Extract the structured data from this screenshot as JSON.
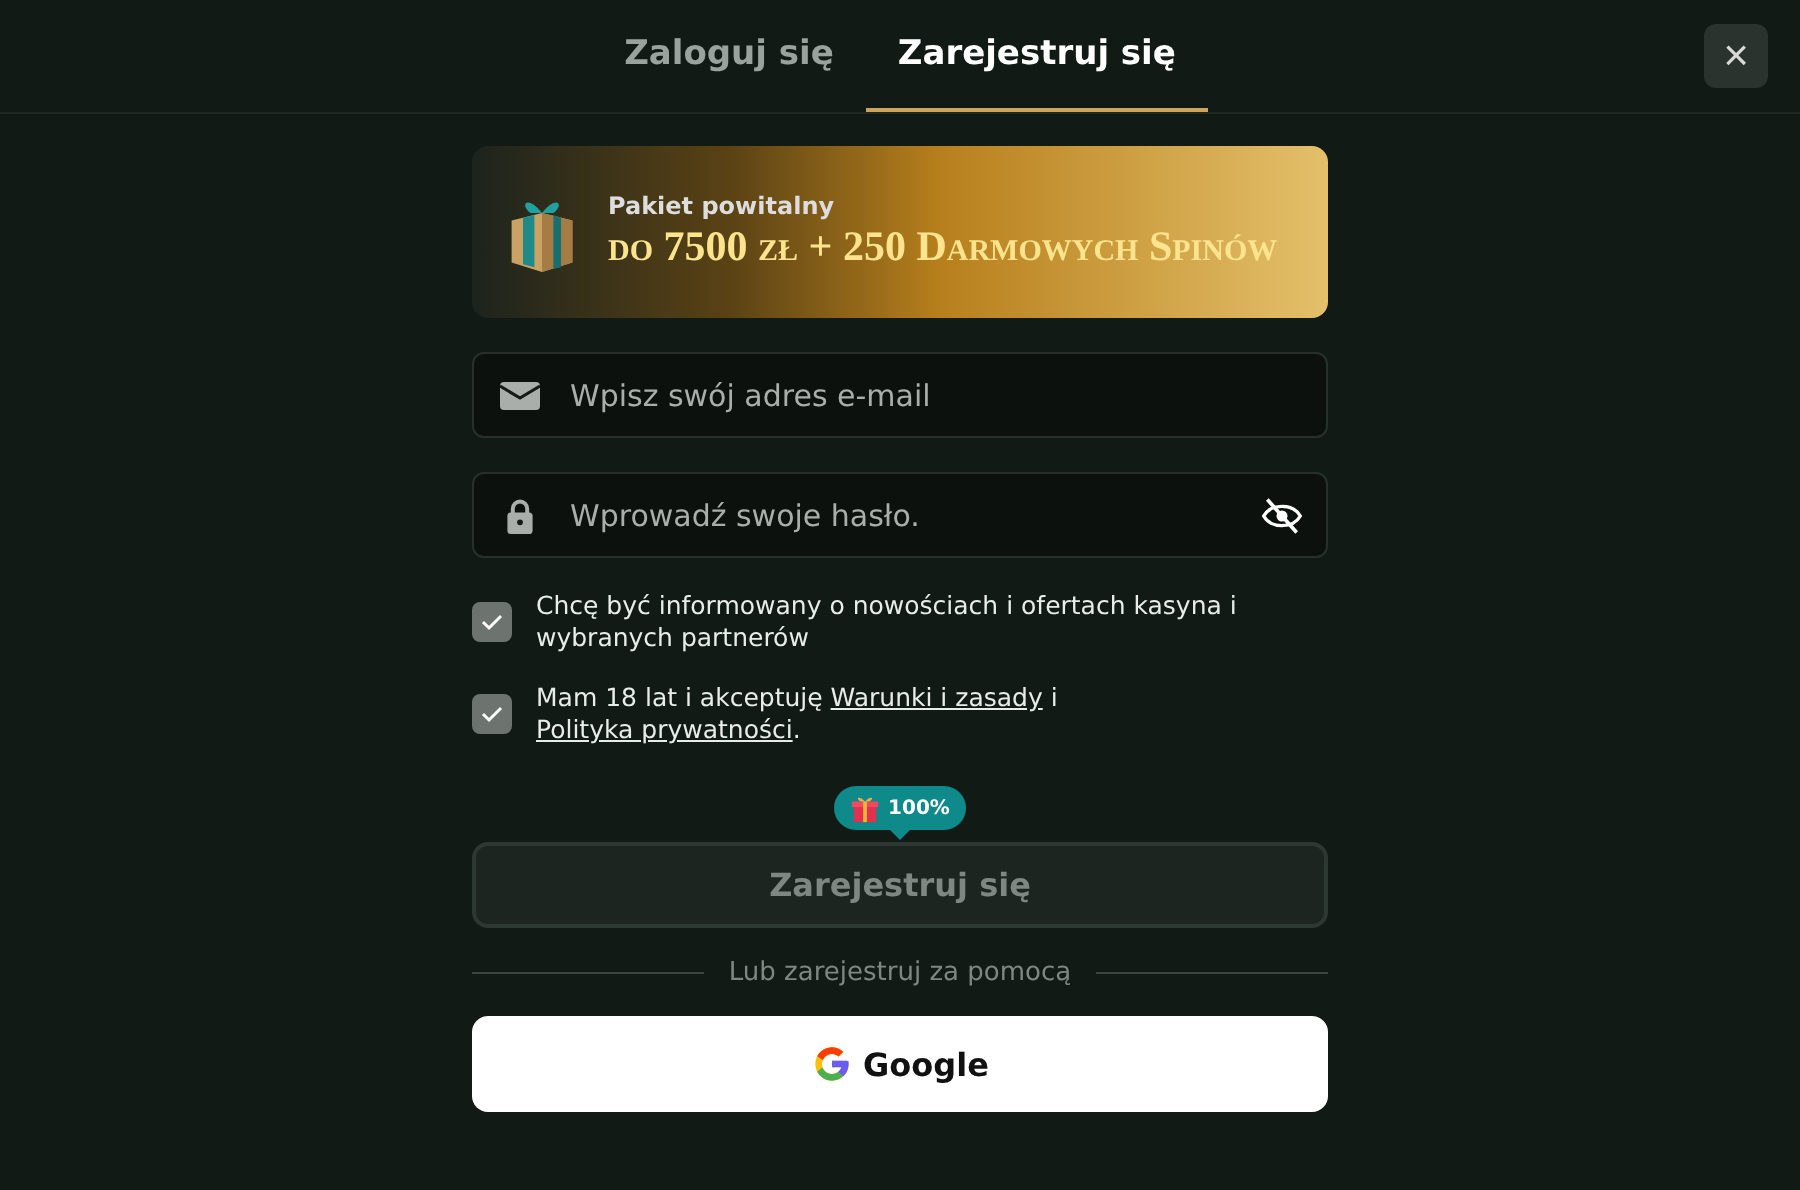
{
  "tabs": [
    {
      "label": "Zaloguj się",
      "selected": false
    },
    {
      "label": "Zarejestruj się",
      "selected": true
    }
  ],
  "close": {
    "label": "×"
  },
  "promo": {
    "subtitle": "Pakiet powitalny",
    "title": "do 7500 zł + 250 Darmowych Spinów"
  },
  "email_field": {
    "placeholder": "Wpisz swój adres e-mail"
  },
  "password_field": {
    "placeholder": "Wprowadź swoje hasło.",
    "visible": false
  },
  "consents": [
    {
      "checked": true,
      "parts": [
        {
          "kind": "text",
          "text": "Chcę być informowany o nowościach i ofertach kasyna i wybranych partnerów"
        }
      ]
    },
    {
      "checked": true,
      "parts": [
        {
          "kind": "text",
          "text": "Mam 18 lat i akceptuję "
        },
        {
          "kind": "link",
          "text": "Warunki i zasady"
        },
        {
          "kind": "text",
          "text": " i "
        },
        {
          "kind": "link",
          "text": "Polityka prywatności"
        },
        {
          "kind": "text",
          "text": "."
        }
      ]
    }
  ],
  "bonus_badge": {
    "text": "100%"
  },
  "register_button": {
    "label": "Zarejestruj się",
    "disabled": true
  },
  "divider_text": "Lub zarejestruj za pomocą",
  "google_button": {
    "label": "Google"
  }
}
